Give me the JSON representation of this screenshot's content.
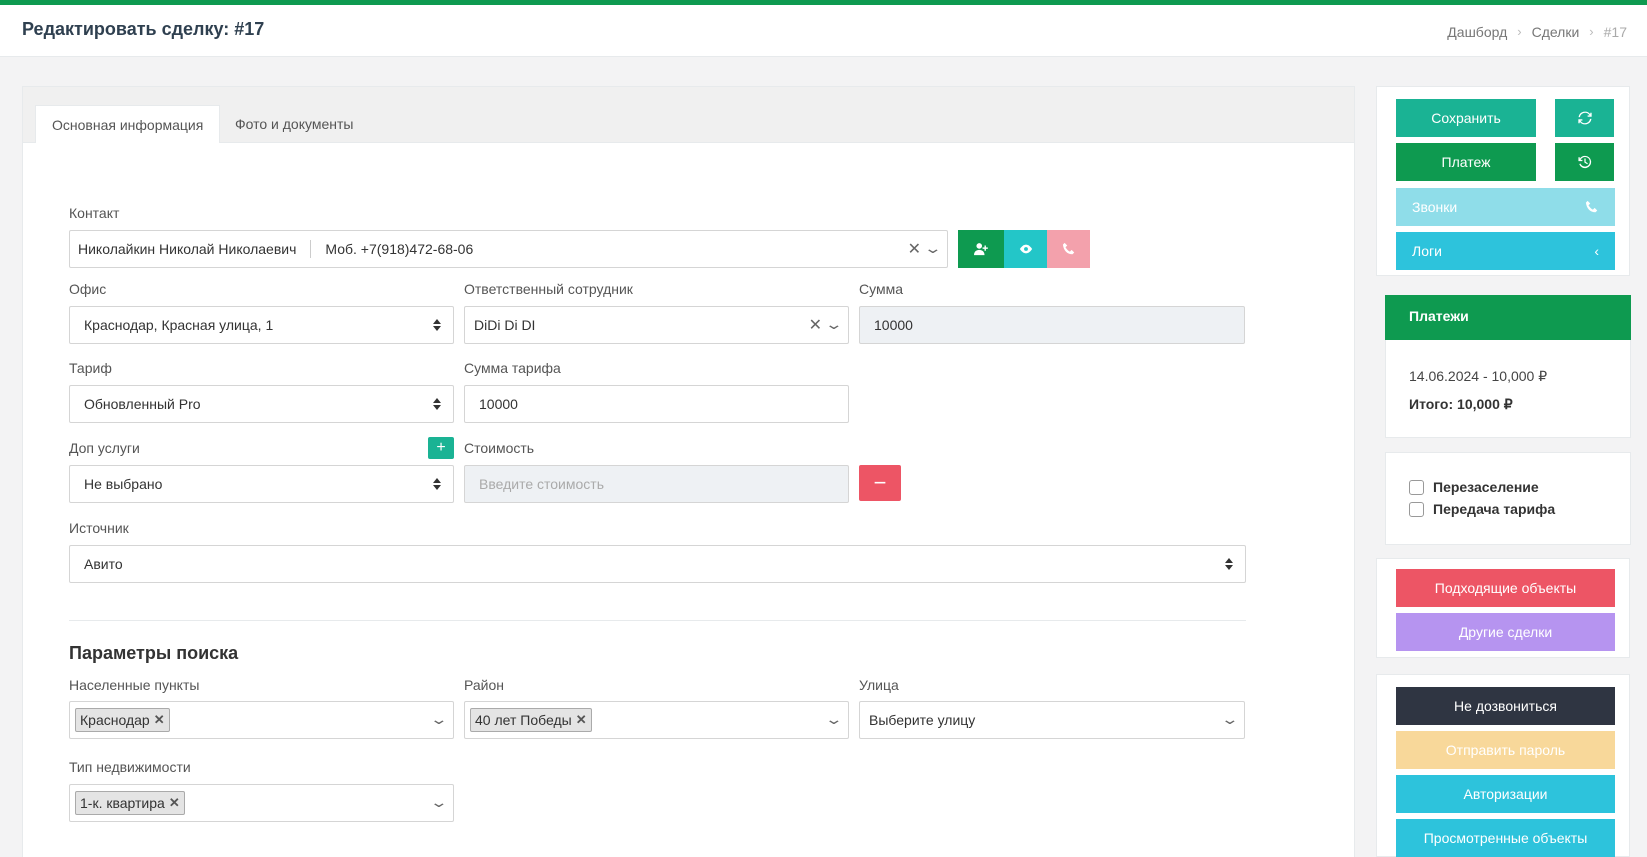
{
  "header": {
    "title": "Редактировать сделку: #17",
    "breadcrumb": [
      "Дашборд",
      "Сделки",
      "#17"
    ]
  },
  "tabs": [
    {
      "label": "Основная информация",
      "active": true
    },
    {
      "label": "Фото и документы",
      "active": false
    }
  ],
  "form": {
    "contact_label": "Контакт",
    "contact_name": "Николайкин Николай Николаевич",
    "contact_phone": "Моб. +7(918)472-68-06",
    "office_label": "Офис",
    "office_value": "Краснодар, Красная улица, 1",
    "employee_label": "Ответственный сотрудник",
    "employee_value": "DiDi Di DI",
    "sum_label": "Сумма",
    "sum_value": "10000",
    "tariff_label": "Тариф",
    "tariff_value": "Обновленный Pro",
    "tariff_sum_label": "Сумма тарифа",
    "tariff_sum_value": "10000",
    "extra_label": "Доп услуги",
    "extra_value": "Не выбрано",
    "cost_label": "Стоимость",
    "cost_placeholder": "Введите стоимость",
    "source_label": "Источник",
    "source_value": "Авито"
  },
  "search": {
    "title": "Параметры поиска",
    "settlements_label": "Населенные пункты",
    "settlements_tag": "Краснодар",
    "district_label": "Район",
    "district_tag": "40 лет Победы",
    "street_label": "Улица",
    "street_placeholder": "Выберите улицу",
    "property_type_label": "Тип недвижимости",
    "property_type_tag": "1-к. квартира"
  },
  "sidebar": {
    "save": "Сохранить",
    "payment": "Платеж",
    "calls": "Звонки",
    "logs": "Логи",
    "payments_title": "Платежи",
    "payment_line": "14.06.2024 - 10,000 ₽",
    "payment_total": "Итого: 10,000 ₽",
    "resettle": "Перезаселение",
    "tariff_transfer": "Передача тарифа",
    "matching_objects": "Подходящие объекты",
    "other_deals": "Другие сделки",
    "not_reached": "Не дозвониться",
    "send_password": "Отправить пароль",
    "authorizations": "Авторизации",
    "viewed_objects": "Просмотренные объекты"
  }
}
